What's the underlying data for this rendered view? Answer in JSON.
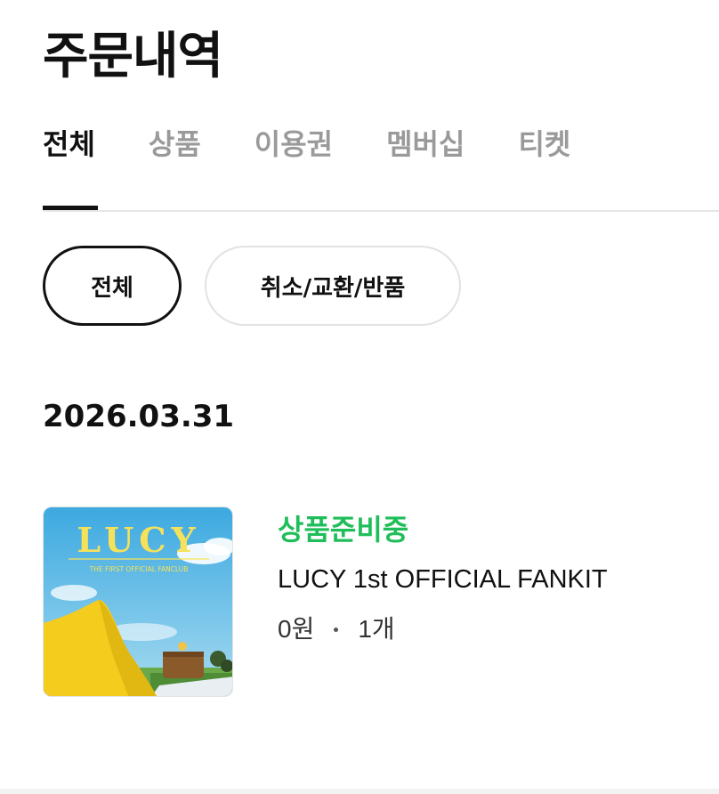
{
  "header": {
    "title": "주문내역"
  },
  "tabs": [
    {
      "label": "전체",
      "active": true
    },
    {
      "label": "상품",
      "active": false
    },
    {
      "label": "이용권",
      "active": false
    },
    {
      "label": "멤버십",
      "active": false
    },
    {
      "label": "티켓",
      "active": false
    }
  ],
  "filters": {
    "all_label": "전체",
    "cancel_label": "취소/교환/반품",
    "selected": "전체"
  },
  "orders": [
    {
      "date": "2026.03.31",
      "items": [
        {
          "status": "상품준비중",
          "status_color": "#1fbe5a",
          "name": "LUCY 1st OFFICIAL FANKIT",
          "price": "0원",
          "quantity": "1개",
          "thumbnail": {
            "logo_text": "LUCY",
            "subtitle": "THE FIRST OFFICIAL FANCLUB"
          }
        }
      ]
    }
  ]
}
